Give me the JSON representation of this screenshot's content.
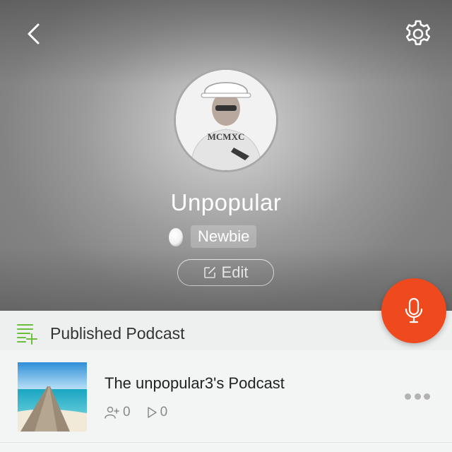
{
  "profile": {
    "username": "Unpopular",
    "level_badge": "Newbie",
    "edit_label": "Edit",
    "avatar_shirt_text": "MCMXC"
  },
  "icons": {
    "back": "chevron-left-icon",
    "settings": "gear-icon",
    "level": "egg-icon",
    "edit": "edit-icon",
    "section": "playlist-add-icon",
    "record": "microphone-icon",
    "followers": "add-user-icon",
    "plays": "play-icon",
    "more": "more-icon"
  },
  "section": {
    "title": "Published Podcast"
  },
  "podcasts": [
    {
      "title": "The unpopular3's Podcast",
      "followers": "0",
      "plays": "0"
    }
  ],
  "colors": {
    "accent": "#ee4a1e",
    "section_icon": "#6bbf3a",
    "text_dark": "#222222",
    "text_muted": "#8a8a8a"
  }
}
